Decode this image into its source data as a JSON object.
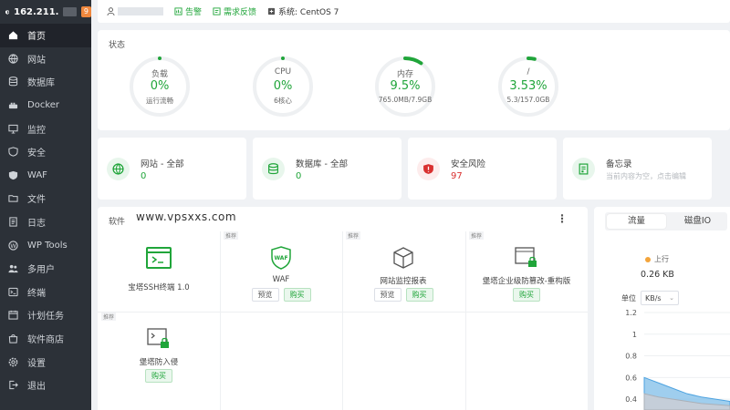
{
  "brand": {
    "ip": "162.211.",
    "badge": "9"
  },
  "topbar": {
    "alerts_label": "告警",
    "feedback_label": "需求反馈",
    "system_label": "系统: CentOS 7"
  },
  "sidebar": {
    "items": [
      {
        "label": "首页",
        "icon": "home-icon"
      },
      {
        "label": "网站",
        "icon": "globe-icon"
      },
      {
        "label": "数据库",
        "icon": "database-icon"
      },
      {
        "label": "Docker",
        "icon": "docker-icon"
      },
      {
        "label": "监控",
        "icon": "monitor-icon"
      },
      {
        "label": "安全",
        "icon": "shield-icon"
      },
      {
        "label": "WAF",
        "icon": "waf-icon"
      },
      {
        "label": "文件",
        "icon": "folder-icon"
      },
      {
        "label": "日志",
        "icon": "log-icon"
      },
      {
        "label": "WP Tools",
        "icon": "wordpress-icon"
      },
      {
        "label": "多用户",
        "icon": "users-icon"
      },
      {
        "label": "终端",
        "icon": "terminal-icon"
      },
      {
        "label": "计划任务",
        "icon": "calendar-icon"
      },
      {
        "label": "软件商店",
        "icon": "store-icon"
      },
      {
        "label": "设置",
        "icon": "gear-icon"
      },
      {
        "label": "退出",
        "icon": "logout-icon"
      }
    ]
  },
  "status": {
    "title": "状态",
    "gauges": [
      {
        "label": "负载",
        "value": "0%",
        "sub": "运行流畅",
        "percent": 0
      },
      {
        "label": "CPU",
        "value": "0%",
        "sub": "6核心",
        "percent": 0
      },
      {
        "label": "内存",
        "value": "9.5%",
        "sub": "765.0MB/7.9GB",
        "percent": 9.5
      },
      {
        "label": "/",
        "value": "3.53%",
        "sub": "5.3/157.0GB",
        "percent": 3.53
      }
    ]
  },
  "stats": [
    {
      "title": "网站 - 全部",
      "value": "0",
      "icon": "globe-icon"
    },
    {
      "title": "数据库 - 全部",
      "value": "0",
      "icon": "database-icon"
    },
    {
      "title": "安全风险",
      "value": "97",
      "icon": "shield-alert-icon"
    },
    {
      "title": "备忘录",
      "hint": "当前内容为空，点击编辑",
      "icon": "memo-icon"
    }
  ],
  "software": {
    "title": "软件",
    "watermark": "www.vpsxxs.com",
    "tag_label": "推荐",
    "preview_label": "预览",
    "buy_label": "购买",
    "items": [
      {
        "name": "宝塔SSH终端 1.0",
        "icon": "terminal-app-icon"
      },
      {
        "name": "WAF",
        "icon": "waf-shield-icon"
      },
      {
        "name": "网站监控报表",
        "icon": "cube-icon"
      },
      {
        "name": "堡塔企业级防篡改-重构版",
        "icon": "lock-window-icon"
      },
      {
        "name": "堡塔防入侵",
        "icon": "lock-terminal-icon"
      }
    ]
  },
  "traffic": {
    "tabs": [
      "流量",
      "磁盘IO"
    ],
    "active_tab": 0,
    "up_label": "上行",
    "up_value": "0.26 KB",
    "unit_label": "单位",
    "unit_value": "KB/s",
    "up_color": "#f3a43b"
  },
  "chart_data": {
    "type": "area",
    "title": "",
    "ylabel": "",
    "yticks": [
      1.2,
      1,
      0.8,
      0.6,
      0.4
    ],
    "ylim": [
      0.3,
      1.2
    ],
    "series": [
      {
        "values": [
          0.6,
          0.55,
          0.5,
          0.45,
          0.42,
          0.4,
          0.38
        ]
      },
      {
        "values": [
          0.45,
          0.42,
          0.4,
          0.38,
          0.36,
          0.35,
          0.34
        ]
      }
    ]
  },
  "colors": {
    "accent": "#20a53a",
    "danger": "#d9302f",
    "sidebar_bg": "#2c3138"
  }
}
